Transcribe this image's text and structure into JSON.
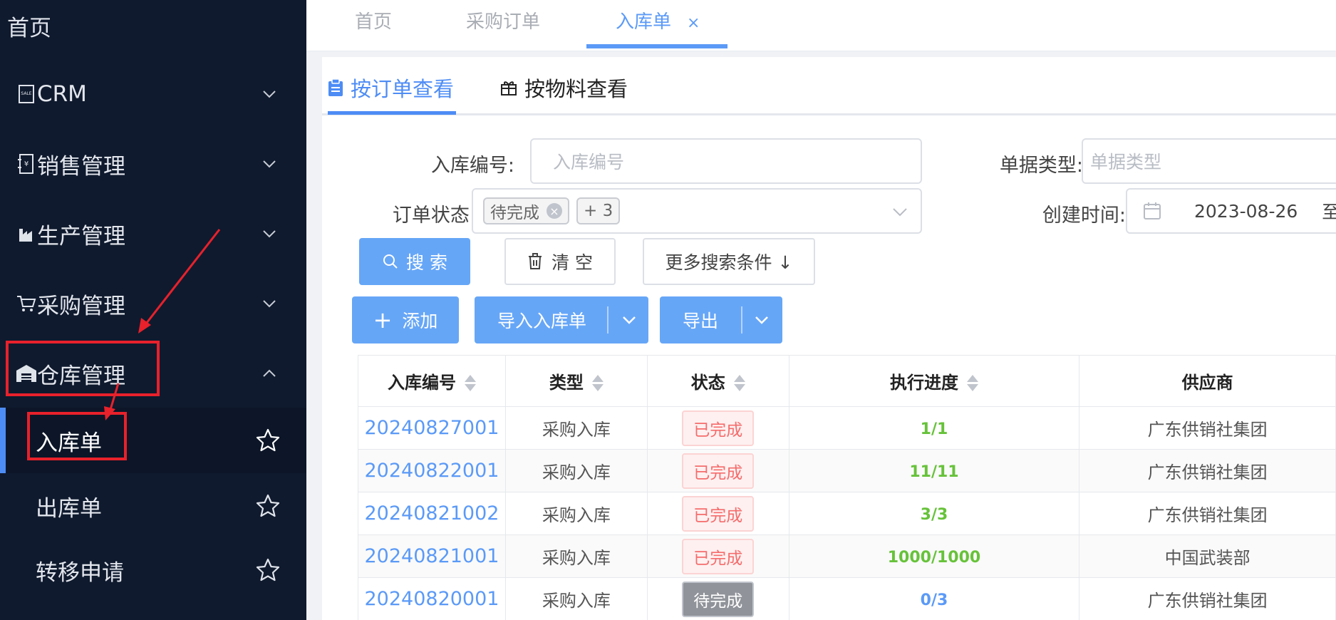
{
  "sidebar": {
    "home": "首页",
    "menus": [
      {
        "label": "CRM"
      },
      {
        "label": "销售管理"
      },
      {
        "label": "生产管理"
      },
      {
        "label": "采购管理"
      },
      {
        "label": "仓库管理"
      }
    ],
    "submenus": [
      {
        "label": "入库单"
      },
      {
        "label": "出库单"
      },
      {
        "label": "转移申请"
      }
    ]
  },
  "tabs": [
    {
      "label": "首页"
    },
    {
      "label": "采购订单"
    },
    {
      "label": "入库单",
      "close": "×"
    }
  ],
  "subtabs": [
    {
      "label": "按订单查看"
    },
    {
      "label": "按物料查看"
    }
  ],
  "filters": {
    "code_label": "入库编号:",
    "code_placeholder": "入库编号",
    "type_label": "单据类型:",
    "type_placeholder": "单据类型",
    "status_label": "订单状态:",
    "status_tag": "待完成",
    "status_more": "+ 3",
    "created_label": "创建时间:",
    "created_start": "2023-08-26",
    "created_sep": "至"
  },
  "buttons": {
    "search": "搜 索",
    "clear": "清 空",
    "more": "更多搜索条件 ↓",
    "add": "添加",
    "import": "导入入库单",
    "export": "导出"
  },
  "table": {
    "headers": [
      "入库编号",
      "类型",
      "状态",
      "执行进度",
      "供应商"
    ],
    "rows": [
      {
        "code": "20240827001",
        "type": "采购入库",
        "status": "已完成",
        "progress": "1/1",
        "supplier": "广东供销社集团"
      },
      {
        "code": "20240822001",
        "type": "采购入库",
        "status": "已完成",
        "progress": "11/11",
        "supplier": "广东供销社集团"
      },
      {
        "code": "20240821002",
        "type": "采购入库",
        "status": "已完成",
        "progress": "3/3",
        "supplier": "广东供销社集团"
      },
      {
        "code": "20240821001",
        "type": "采购入库",
        "status": "已完成",
        "progress": "1000/1000",
        "supplier": "中国武装部"
      },
      {
        "code": "20240820001",
        "type": "采购入库",
        "status": "待完成",
        "progress": "0/3",
        "supplier": "广东供销社集团"
      }
    ]
  },
  "colors": {
    "sidebar_bg": "#0f1a2e",
    "accent": "#5b9af7",
    "progress_done": "#67c23a",
    "progress_pending": "#5b9af7",
    "annotation": "#e8212b"
  }
}
